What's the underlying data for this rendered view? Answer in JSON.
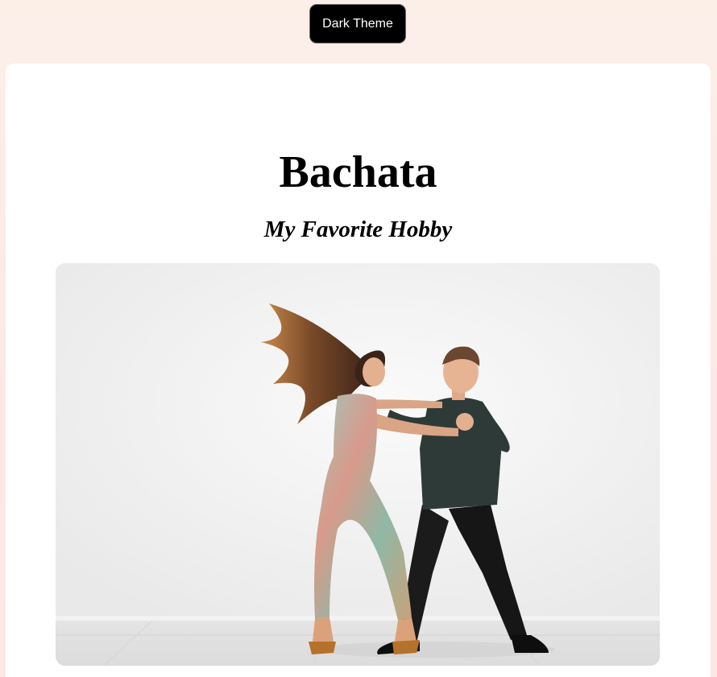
{
  "header": {
    "theme_button_label": "Dark Theme"
  },
  "main": {
    "title": "Bachata",
    "subtitle": "My Favorite Hobby",
    "image": {
      "subject": "couple-dancing-bachata"
    }
  },
  "colors": {
    "page_background": "#fcefe8",
    "card_background": "#ffffff",
    "button_background": "#000000",
    "button_text": "#ffffff"
  }
}
